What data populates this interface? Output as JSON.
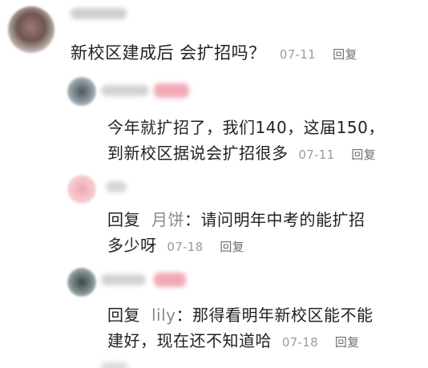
{
  "comment": {
    "text": "新校区建成后 会扩招吗？",
    "time": "07-11",
    "reply_label": "回复"
  },
  "replies": [
    {
      "line1": "今年就扩招了，我们140，这届150，",
      "line2": "到新校区据说会扩招很多",
      "time": "07-11",
      "reply_label": "回复"
    },
    {
      "lead": "回复",
      "at": "月饼",
      "separator": "：",
      "line1": "请问明年中考的能扩招",
      "line2": "多少呀",
      "time": "07-18",
      "reply_label": "回复"
    },
    {
      "lead": "回复",
      "at": "lily",
      "separator": "：",
      "line1": "那得看明年新校区能不能",
      "line2": "建好，现在还不知道哈",
      "time": "07-18",
      "reply_label": "回复"
    }
  ]
}
